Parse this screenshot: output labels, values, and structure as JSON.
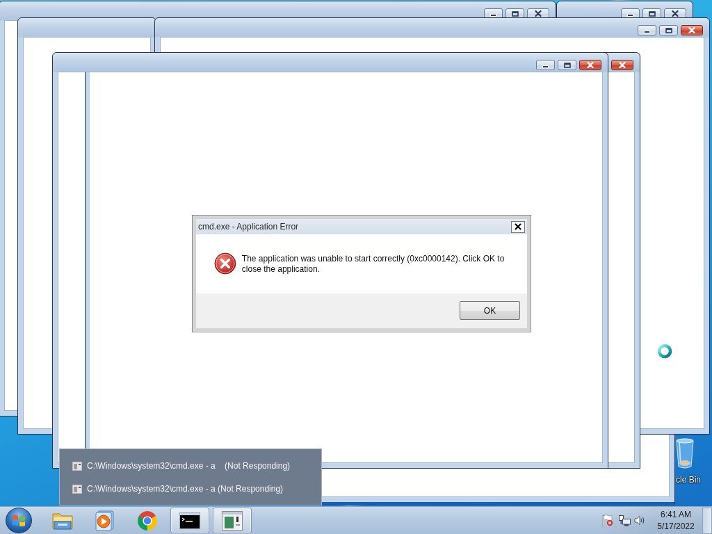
{
  "windows": [
    {
      "active": false
    },
    {
      "active": false
    },
    {
      "active": true
    },
    {
      "active": true
    },
    {
      "active": true
    }
  ],
  "dialog": {
    "title": "cmd.exe - Application Error",
    "message": "The application was unable to start correctly (0xc0000142). Click OK to close the application.",
    "buttons": [
      "OK"
    ]
  },
  "desktop_icons": [
    {
      "label": "cle Bin"
    }
  ],
  "window_list": {
    "items": [
      {
        "label": "C:\\Windows\\system32\\cmd.exe - a    (Not Responding)"
      },
      {
        "label": "C:\\Windows\\system32\\cmd.exe - a (Not Responding)"
      }
    ]
  },
  "taskbar": {
    "buttons": [
      {
        "running": false
      },
      {
        "running": false
      },
      {
        "running": false
      },
      {
        "running": true
      },
      {
        "running": true
      }
    ],
    "clock": {
      "time": "6:41 AM",
      "date": "5/17/2022"
    }
  }
}
